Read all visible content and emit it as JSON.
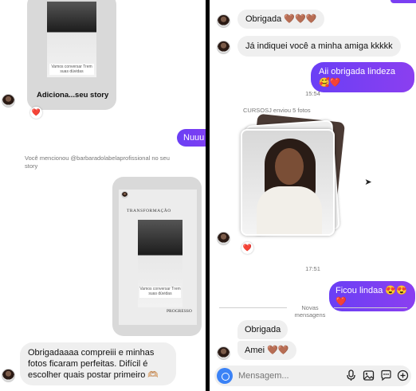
{
  "left": {
    "story_reply_1": {
      "caption": "Adiciona...seu story",
      "mini_text": "Vamos conversar Trem suas dúvidas"
    },
    "heart_reaction": "❤️",
    "sent_1": "Nuuu",
    "mention_notice": "Você mencionou @barbaradolabelaprofissional no seu story",
    "story_2": {
      "mini_text": "Vamos conversar Trem suas dúvidas",
      "title_top": "TRANSFORMAÇÃO",
      "title_bottom": "PROGRESSO"
    },
    "received_long": "Obrigadaaaa compreiii e minhas fotos ficaram perfeitas. Difícil é escolher quais postar primeiro 🫶🏼"
  },
  "right": {
    "msg_obrigada_1": "Obrigada 🤎🤎🤎",
    "msg_indiquei": "Já indiquei você a minha amiga kkkkk",
    "sent_obrigada_lindeza": "Aii obrigada lindeza 🥰❤️",
    "time_1": "15:54",
    "photos_notice": "CURSOSJ enviou 5 fotos",
    "heart_reaction": "❤️",
    "time_2": "17:51",
    "sent_ficou_lindaa": "Ficou lindaa 😍😍❤️",
    "new_messages": "Novas mensagens",
    "msg_obrigada_2": "Obrigada",
    "msg_amei": "Amei 🤎🤎",
    "input_placeholder": "Mensagem..."
  }
}
